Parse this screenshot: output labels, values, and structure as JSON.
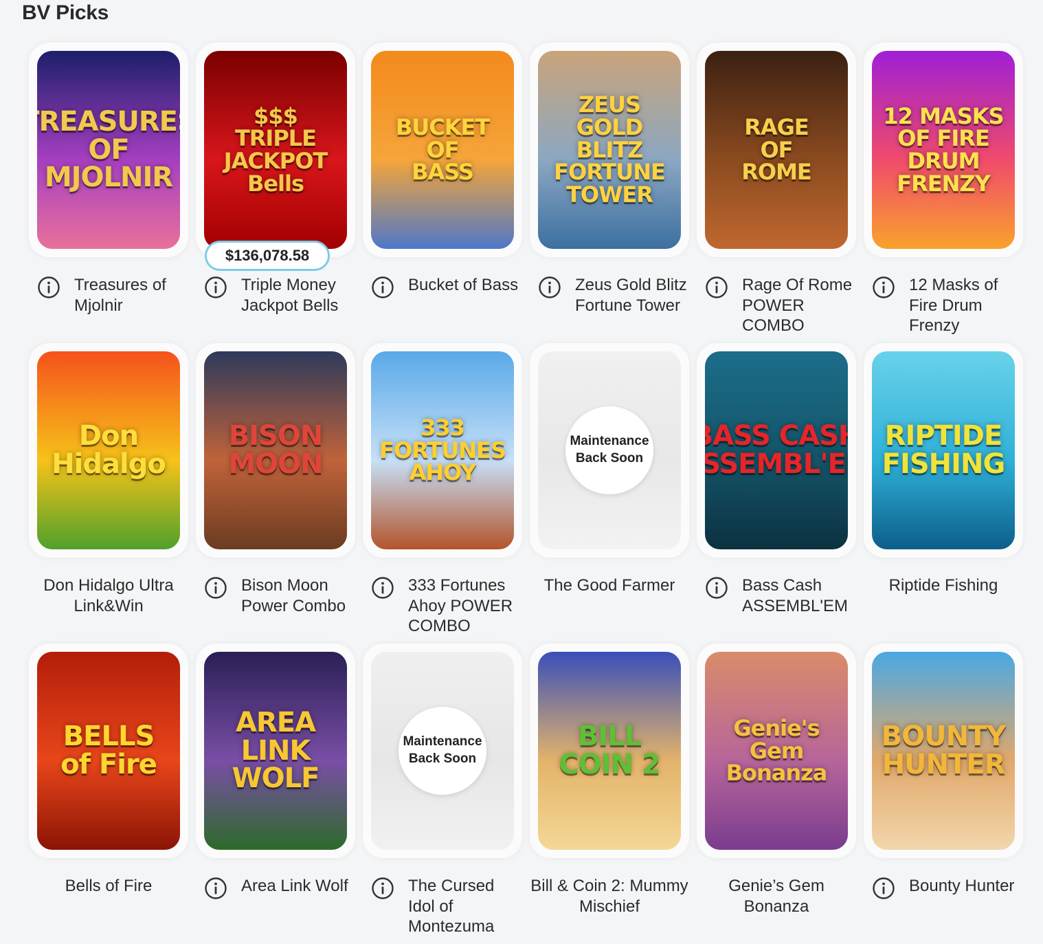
{
  "section": {
    "title": "BV Picks"
  },
  "maintenance_text": "Maintenance\nBack Soon",
  "games": [
    {
      "name": "Treasures of Mjolnir",
      "info": true,
      "art": "TREASURES OF\nMJOLNIR",
      "bg": [
        "#1c1f6b",
        "#a63fc1",
        "#e8719a"
      ],
      "fg": "#f2c94c"
    },
    {
      "name": "Triple Money Jackpot Bells",
      "info": true,
      "art": "$$$\nTRIPLE\nJACKPOT\nBells",
      "bg": [
        "#7a0000",
        "#d8161b",
        "#a20000"
      ],
      "fg": "#f5c84b",
      "jackpot": "$136,078.58"
    },
    {
      "name": "Bucket of Bass",
      "info": true,
      "art": "BUCKET\nOF\nBASS",
      "bg": [
        "#f38a1c",
        "#f5a53a",
        "#4e78c8"
      ],
      "fg": "#ffd43b"
    },
    {
      "name": "Zeus Gold Blitz Fortune Tower",
      "info": true,
      "art": "ZEUS\nGOLD BLITZ\nFORTUNE TOWER",
      "bg": [
        "#c9a47a",
        "#8ca7c2",
        "#3c6fa0"
      ],
      "fg": "#ffd23f"
    },
    {
      "name": "Rage Of Rome POWER COMBO",
      "info": true,
      "art": "RAGE\nOF\nROME",
      "bg": [
        "#3b2012",
        "#8b4b1f",
        "#c06730"
      ],
      "fg": "#f7cf4d"
    },
    {
      "name": "12 Masks of Fire Drum Frenzy",
      "info": true,
      "art": "12 MASKS OF FIRE\nDRUM\nFRENZY",
      "bg": [
        "#9f1fd6",
        "#f04b6b",
        "#f9a22c"
      ],
      "fg": "#ffe14d"
    },
    {
      "name": "Don Hidalgo Ultra Link&Win",
      "info": false,
      "art": "Don\nHidalgo",
      "bg": [
        "#f5521b",
        "#f7c21a",
        "#4fa12a"
      ],
      "fg": "#ffde3b"
    },
    {
      "name": "Bison Moon Power Combo",
      "info": true,
      "art": "BISON\nMOON",
      "bg": [
        "#2d3a5b",
        "#c0633a",
        "#6b3c21"
      ],
      "fg": "#e0453a"
    },
    {
      "name": "333 Fortunes Ahoy POWER COMBO",
      "info": true,
      "art": "333\nFORTUNES\nAHOY",
      "bg": [
        "#59a9e8",
        "#c6e0f7",
        "#b3542b"
      ],
      "fg": "#ffcf2e"
    },
    {
      "name": "The Good Farmer",
      "info": false,
      "maintenance": true,
      "bg": [
        "#f0f0f0",
        "#e8e8e8",
        "#f2f2f2"
      ],
      "fg": "#d8d8d8"
    },
    {
      "name": "Bass Cash ASSEMBL'EM",
      "info": true,
      "art": "BASS CASH\nASSEMBL'EM",
      "bg": [
        "#1c6d8a",
        "#145468",
        "#0c3140"
      ],
      "fg": "#e5252a"
    },
    {
      "name": "Riptide Fishing",
      "info": false,
      "art": "RIPTIDE\nFISHING",
      "bg": [
        "#68d2ea",
        "#2fb0d8",
        "#0b5f8a"
      ],
      "fg": "#f0e33a"
    },
    {
      "name": "Bells of Fire",
      "info": false,
      "art": "BELLS\nof Fire",
      "bg": [
        "#b31e0a",
        "#e8461a",
        "#8c1405"
      ],
      "fg": "#ffd630"
    },
    {
      "name": "Area Link Wolf",
      "info": true,
      "art": "AREA LINK\nWOLF",
      "bg": [
        "#2a1f55",
        "#7a4ea6",
        "#2d6b2a"
      ],
      "fg": "#f7c734"
    },
    {
      "name": "The Cursed Idol of Montezuma",
      "info": true,
      "maintenance": true,
      "bg": [
        "#efefef",
        "#e6e6e6",
        "#f1f1f1"
      ],
      "fg": "#d8d8d8"
    },
    {
      "name": "Bill & Coin 2: Mummy Mischief",
      "info": false,
      "art": "BILL\nCOIN 2",
      "bg": [
        "#3a4fb8",
        "#e3b36a",
        "#f4d896"
      ],
      "fg": "#5fbf35"
    },
    {
      "name": "Genie’s Gem Bonanza",
      "info": false,
      "art": "Genie's\nGem\nBonanza",
      "bg": [
        "#d98c6a",
        "#b7659a",
        "#7a3c8e"
      ],
      "fg": "#f5c140"
    },
    {
      "name": "Bounty Hunter",
      "info": true,
      "art": "BOUNTY\nHUNTER",
      "bg": [
        "#4aa8e3",
        "#e1a86a",
        "#f2d6ad"
      ],
      "fg": "#f2b73a"
    }
  ]
}
